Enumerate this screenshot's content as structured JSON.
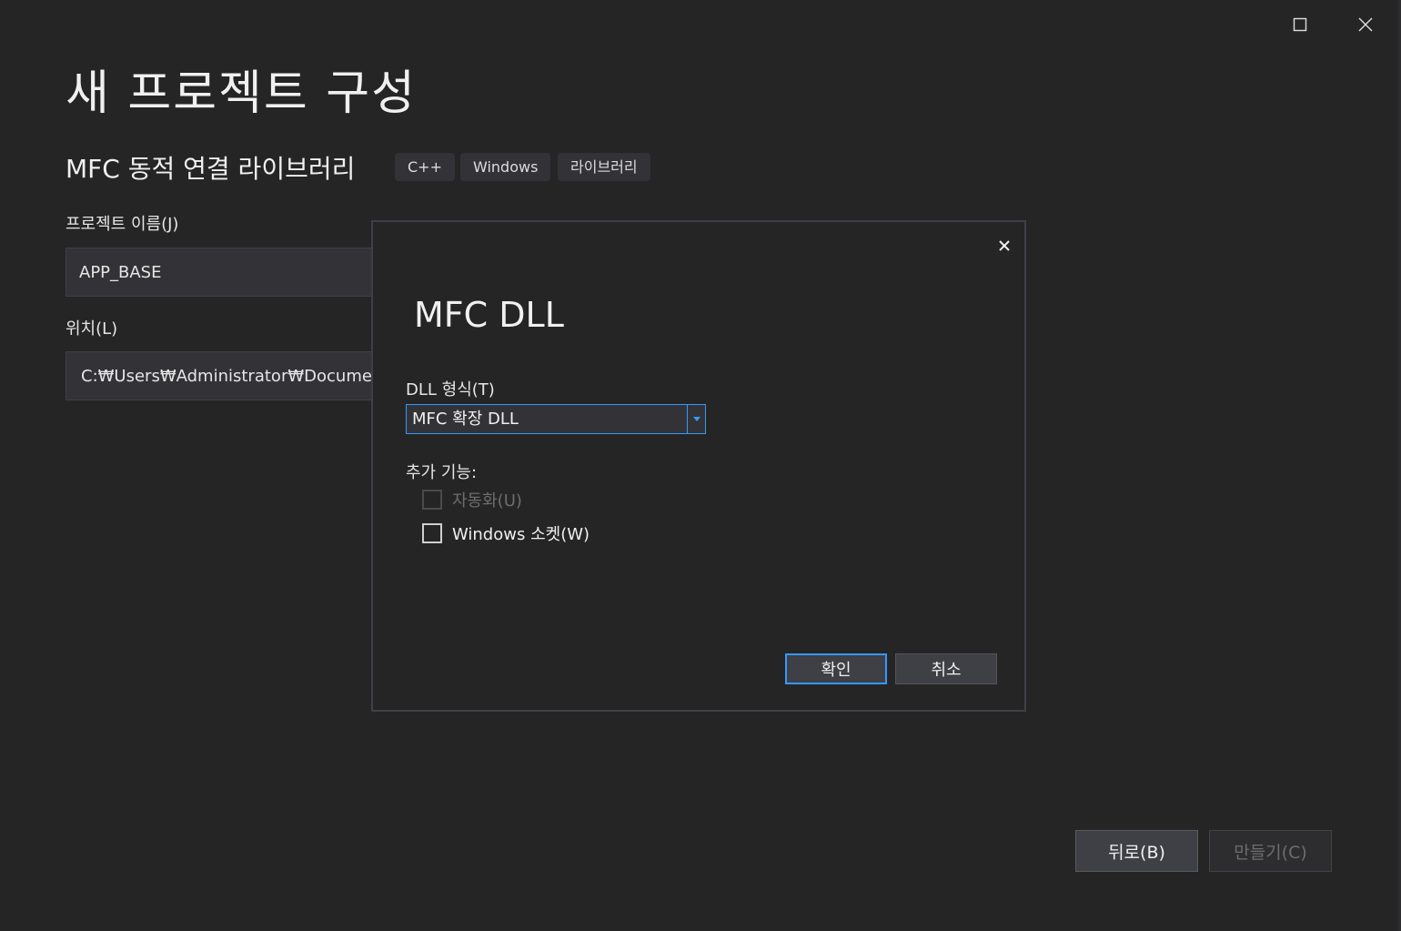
{
  "window": {
    "maximize_icon": "maximize-icon",
    "close_icon": "close-icon"
  },
  "page": {
    "title": "새 프로젝트 구성",
    "template_name": "MFC 동적 연결 라이브러리",
    "tags": [
      "C++",
      "Windows",
      "라이브러리"
    ]
  },
  "form": {
    "project_name_label": "프로젝트 이름(J)",
    "project_name_value": "APP_BASE",
    "location_label": "위치(L)",
    "location_value": "C:₩Users₩Administrator₩Documents₩"
  },
  "dialog": {
    "title": "MFC DLL",
    "close_icon": "close-icon",
    "dll_type_label": "DLL 형식(T)",
    "dll_type_selected": "MFC 확장 DLL",
    "features_label": "추가 기능:",
    "features": [
      {
        "label": "자동화(U)",
        "checked": false,
        "disabled": true
      },
      {
        "label": "Windows 소켓(W)",
        "checked": false,
        "disabled": false
      }
    ],
    "ok_label": "확인",
    "cancel_label": "취소"
  },
  "footer": {
    "back_label": "뒤로(B)",
    "create_label": "만들기(C)"
  },
  "colors": {
    "background": "#252526",
    "accent": "#3399ff",
    "field": "#333337"
  }
}
